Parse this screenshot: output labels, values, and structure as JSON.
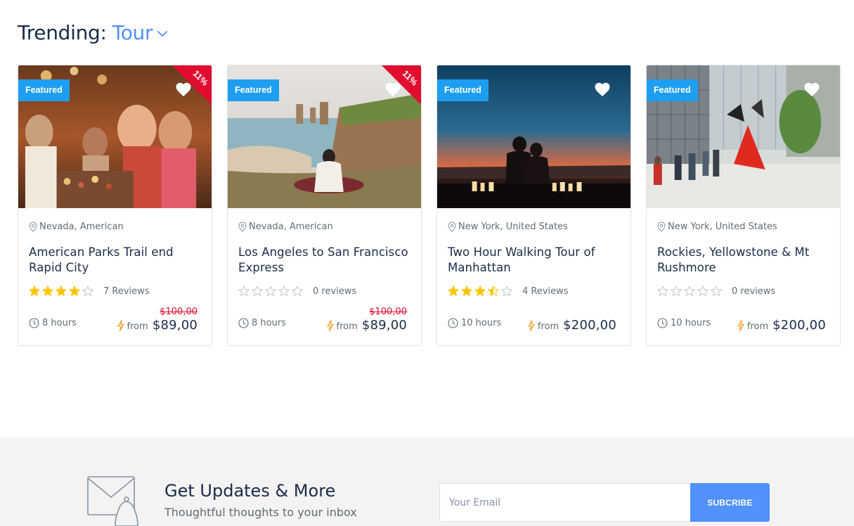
{
  "trending": {
    "label": "Trending:",
    "value": "Tour",
    "icon": "chevron-down-icon"
  },
  "colors": {
    "accent": "#5191fa",
    "featured": "#1e9ef0",
    "ribbon": "#e00d2f",
    "star": "#fac500",
    "bolt": "#fa9b1e"
  },
  "cards": [
    {
      "badge": "Featured",
      "discount": "11%",
      "location": "Nevada, American",
      "title": "American Parks Trail end Rapid City",
      "rating": 4,
      "reviews": "7 Reviews",
      "duration": "8 hours",
      "old_price": "$100,00",
      "from": "from",
      "price": "$89,00"
    },
    {
      "badge": "Featured",
      "discount": "11%",
      "location": "Nevada, American",
      "title": "Los Angeles to San Francisco Express",
      "rating": 0,
      "reviews": "0 reviews",
      "duration": "8 hours",
      "old_price": "$100,00",
      "from": "from",
      "price": "$89,00"
    },
    {
      "badge": "Featured",
      "discount": "",
      "location": "New York, United States",
      "title": "Two Hour Walking Tour of Manhattan",
      "rating": 3.5,
      "reviews": "4 Reviews",
      "duration": "10 hours",
      "old_price": "",
      "from": "from",
      "price": "$200,00"
    },
    {
      "badge": "Featured",
      "discount": "",
      "location": "New York, United States",
      "title": "Rockies, Yellowstone & Mt Rushmore",
      "rating": 0,
      "reviews": "0 reviews",
      "duration": "10 hours",
      "old_price": "",
      "from": "from",
      "price": "$200,00"
    }
  ],
  "newsletter": {
    "title": "Get Updates & More",
    "subtitle": "Thoughtful thoughts to your inbox",
    "placeholder": "Your Email",
    "button": "SUBCRIBE",
    "icon": "mail-bell-icon"
  }
}
